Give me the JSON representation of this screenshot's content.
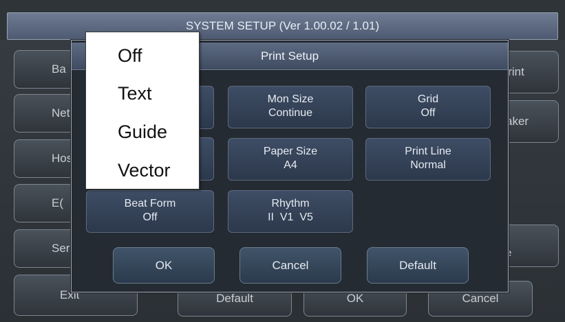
{
  "window": {
    "title": "SYSTEM SETUP (Ver 1.00.02 / 1.01)"
  },
  "background": {
    "left_buttons": [
      "Basic",
      "Network",
      "Hospital",
      "ECG",
      "Service",
      "Exit"
    ],
    "left_visible": [
      "Ba",
      "Net",
      "Hos",
      "E(",
      "Ser",
      "Exit"
    ],
    "right_buttons": [
      {
        "visible": "'rint"
      },
      {
        "visible": "aker"
      },
      {
        "visible_l1": "t",
        "visible_l2": "e"
      }
    ],
    "bottom_buttons": {
      "default": "Default",
      "ok": "OK",
      "cancel": "Cancel"
    }
  },
  "dialog": {
    "title": "Print Setup",
    "settings": [
      {
        "label": "Mon Size",
        "value": "Continue"
      },
      {
        "label": "Grid",
        "value": "Off"
      },
      {
        "label": "Paper Size",
        "value": "A4"
      },
      {
        "label": "Print Line",
        "value": "Normal"
      },
      {
        "label": "Beat Form",
        "value": "Off"
      },
      {
        "label": "Rhythm",
        "value": "II  V1  V5"
      }
    ],
    "actions": {
      "ok": "OK",
      "cancel": "Cancel",
      "default": "Default"
    }
  },
  "popup_menu": {
    "options": [
      "Off",
      "Text",
      "Guide",
      "Vector"
    ]
  },
  "colors": {
    "dialog_bg": "#252b32",
    "title_bar": "#5d6b83",
    "popup_bg": "#ffffff"
  }
}
